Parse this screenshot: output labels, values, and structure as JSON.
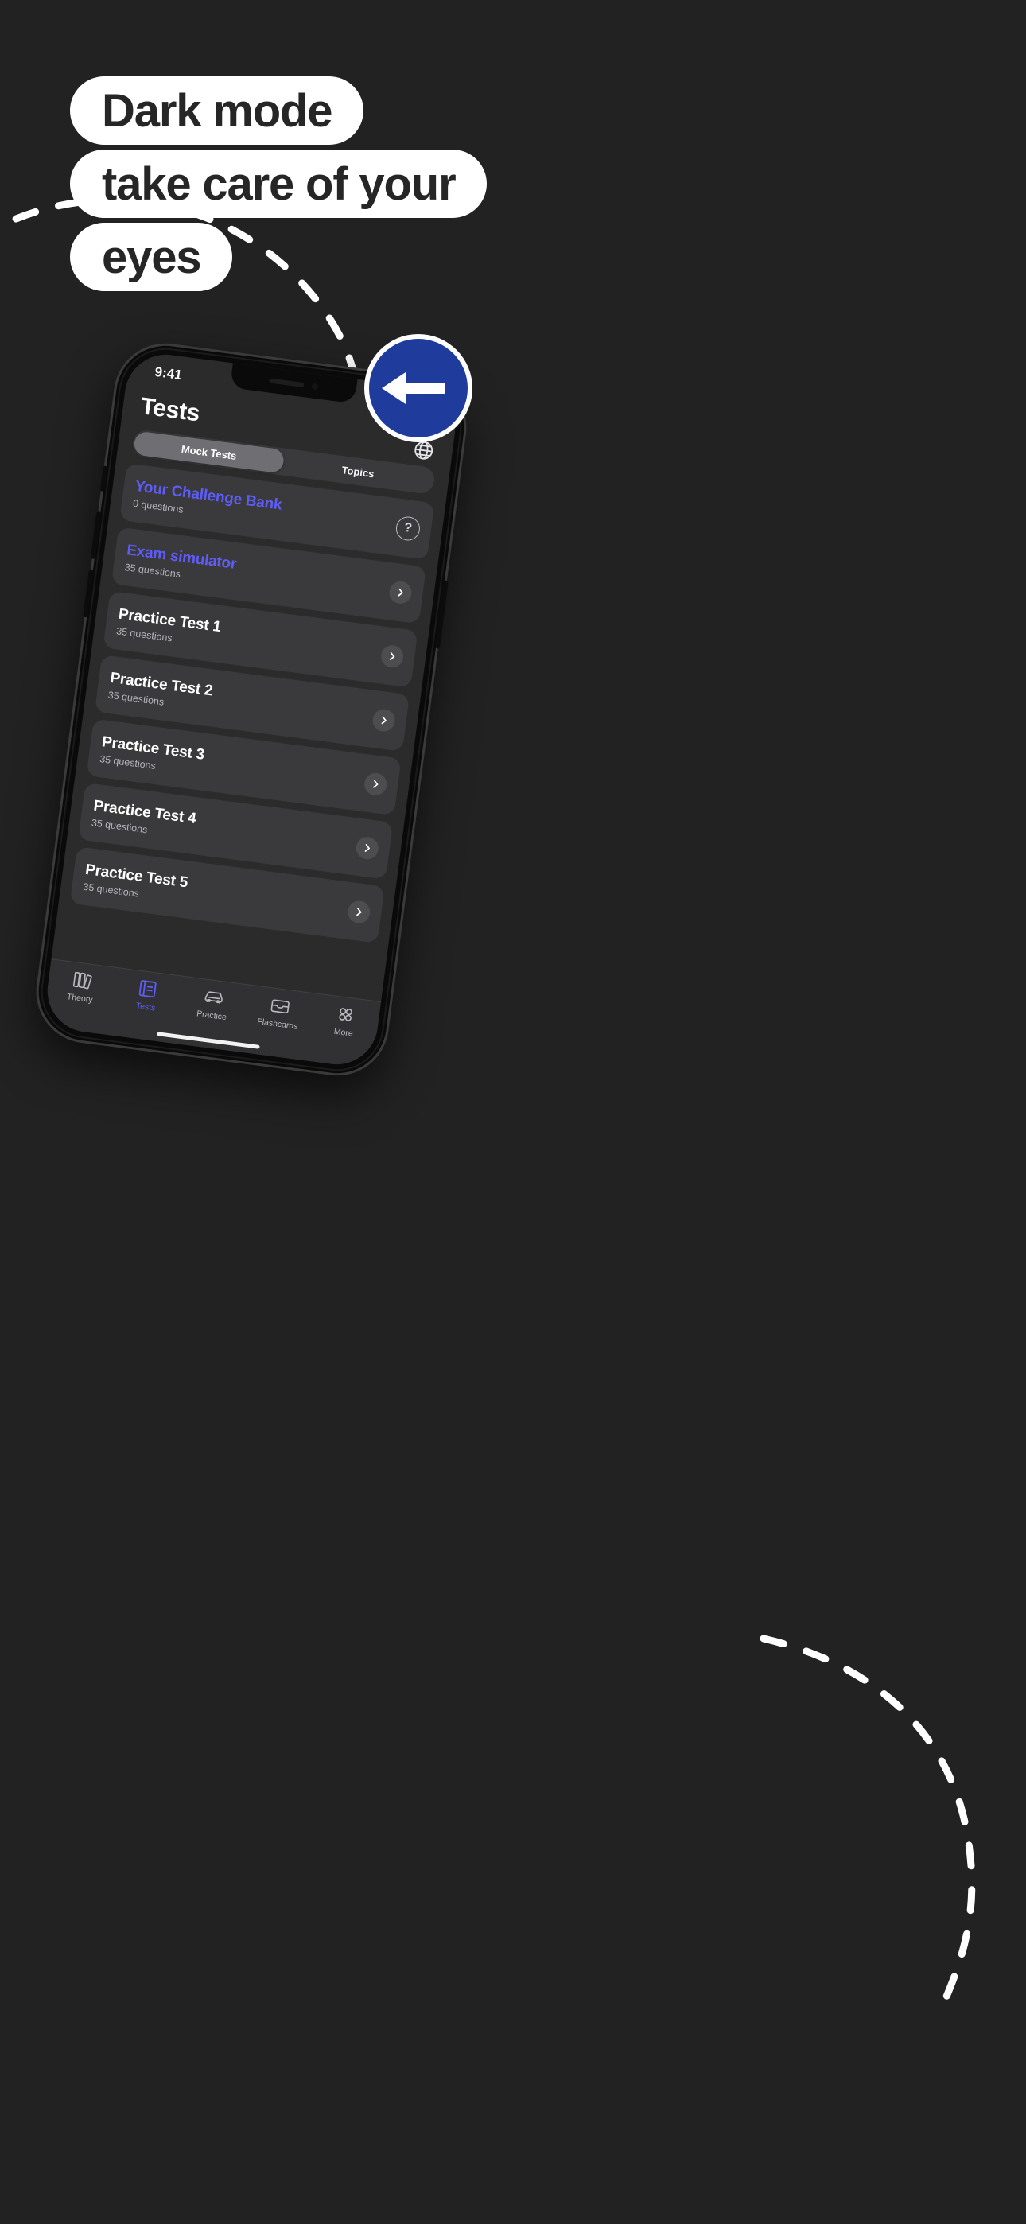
{
  "background_color": "#222222",
  "marketing": {
    "headline_lines": [
      "Dark mode",
      "take care of your",
      "eyes"
    ],
    "pill_bg": "#ffffff",
    "pill_text_color": "#262626",
    "road_sign": {
      "name": "turn-left-ahead-sign",
      "fill": "#1f3b9b",
      "ring": "#ffffff",
      "arrow": "#ffffff"
    },
    "dash_color": "#ffffff"
  },
  "phone": {
    "status_bar": {
      "time": "9:41"
    },
    "header": {
      "title": "Tests",
      "globe_icon": "globe-icon"
    },
    "segmented": {
      "selected": "Mock Tests",
      "options": [
        "Mock Tests",
        "Topics"
      ]
    },
    "accent_color": "#5d5df6",
    "cards": [
      {
        "title": "Your Challenge Bank",
        "subtitle": "0 questions",
        "accent": true,
        "trailing": "help"
      },
      {
        "title": "Exam simulator",
        "subtitle": "35 questions",
        "accent": true,
        "trailing": "chevron"
      },
      {
        "title": "Practice Test 1",
        "subtitle": "35 questions",
        "accent": false,
        "trailing": "chevron"
      },
      {
        "title": "Practice Test 2",
        "subtitle": "35 questions",
        "accent": false,
        "trailing": "chevron"
      },
      {
        "title": "Practice Test 3",
        "subtitle": "35 questions",
        "accent": false,
        "trailing": "chevron"
      },
      {
        "title": "Practice Test 4",
        "subtitle": "35 questions",
        "accent": false,
        "trailing": "chevron"
      },
      {
        "title": "Practice Test 5",
        "subtitle": "35 questions",
        "accent": false,
        "trailing": "chevron"
      }
    ],
    "help_badge_label": "?",
    "tabbar": [
      {
        "label": "Theory",
        "icon": "books-icon",
        "active": false
      },
      {
        "label": "Tests",
        "icon": "notebook-icon",
        "active": true
      },
      {
        "label": "Practice",
        "icon": "car-icon",
        "active": false
      },
      {
        "label": "Flashcards",
        "icon": "flashcard-icon",
        "active": false
      },
      {
        "label": "More",
        "icon": "grid-dots-icon",
        "active": false
      }
    ]
  }
}
